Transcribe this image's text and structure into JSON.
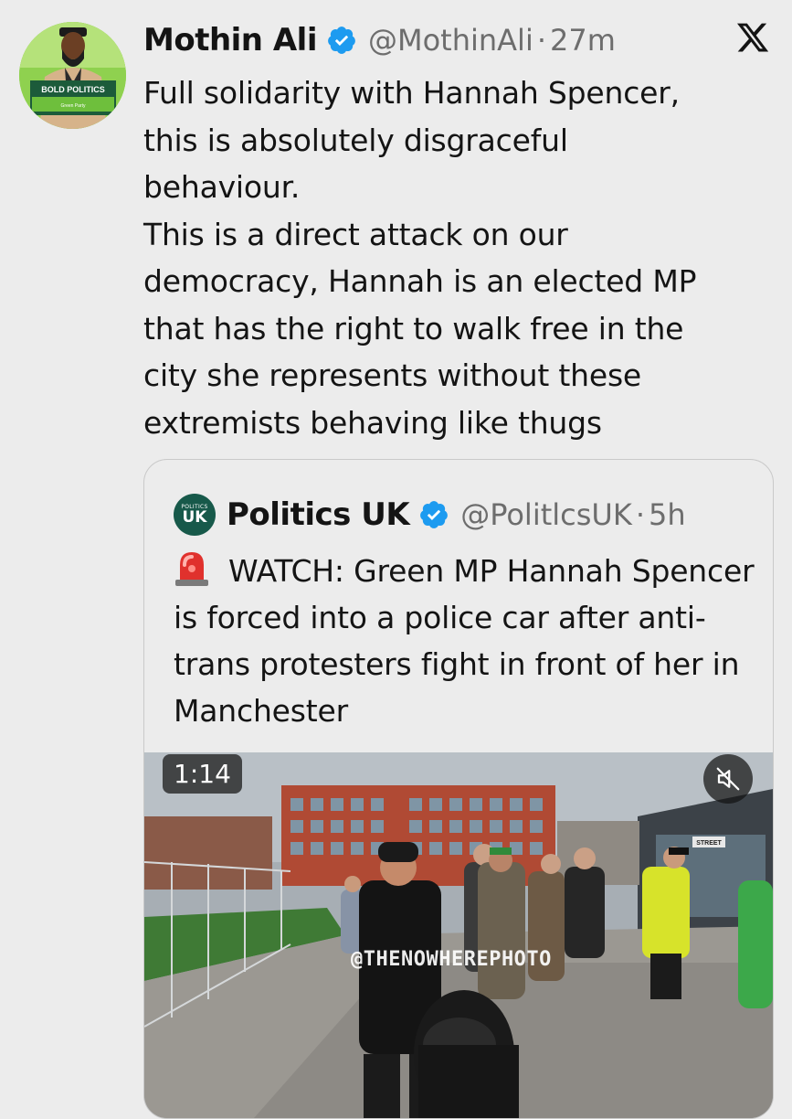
{
  "tweet": {
    "author_name": "Mothin Ali",
    "handle": "@MothinAli",
    "separator": "·",
    "time": "27m",
    "text": "Full solidarity with Hannah Spencer,\nthis is absolutely disgraceful\nbehaviour.\nThis is a direct attack on our\ndemocracy, Hannah is an elected MP\nthat has the right to walk free in the\ncity she represents without these\nextremists behaving like thugs",
    "avatar_sign": "BOLD POLITICS",
    "avatar_sub": "Green Party"
  },
  "quote": {
    "author_name": "Politics UK",
    "avatar_top": "POLITICS",
    "avatar_bottom": "UK",
    "handle": "@PolitlcsUK",
    "separator": "·",
    "time": "5h",
    "text": "WATCH: Green MP Hannah Spencer is forced into a police car after anti-trans protesters fight in front of her in Manchester",
    "video": {
      "duration": "1:14",
      "watermark": "@THENOWHEREPHOTO",
      "street_sign": "STREET"
    }
  },
  "icons": {
    "verified": "verified-badge-icon",
    "x_logo": "x-logo-icon",
    "siren": "police-siren-emoji-icon",
    "mute": "speaker-muted-icon"
  },
  "colors": {
    "background": "#ececec",
    "verified": "#1d9bf0",
    "text": "#141414",
    "muted_text": "#6d6d6d",
    "green_avatar": "#8fd14f",
    "quote_avatar": "#17594a",
    "siren_red": "#e0312d"
  }
}
